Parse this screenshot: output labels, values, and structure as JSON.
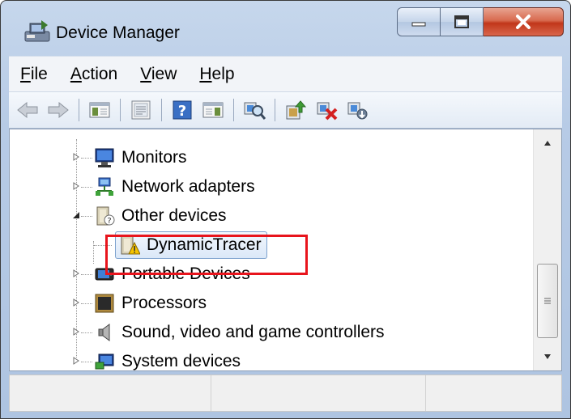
{
  "window": {
    "title": "Device Manager"
  },
  "menu": {
    "items": [
      {
        "label": "File",
        "mnemonic": "F",
        "rest": "ile"
      },
      {
        "label": "Action",
        "mnemonic": "A",
        "rest": "ction"
      },
      {
        "label": "View",
        "mnemonic": "V",
        "rest": "iew"
      },
      {
        "label": "Help",
        "mnemonic": "H",
        "rest": "elp"
      }
    ]
  },
  "toolbar": {
    "buttons": [
      "back-icon",
      "forward-icon",
      "show-hide-console-tree-icon",
      "properties-icon",
      "help-icon",
      "show-action-pane-icon",
      "scan-hardware-changes-icon",
      "update-driver-icon",
      "uninstall-icon",
      "disable-device-icon"
    ]
  },
  "tree": {
    "items": [
      {
        "label": "Monitors",
        "icon": "monitor-icon",
        "expanded": false
      },
      {
        "label": "Network adapters",
        "icon": "network-adapter-icon",
        "expanded": false
      },
      {
        "label": "Other devices",
        "icon": "unknown-device-icon",
        "expanded": true
      },
      {
        "label": "DynamicTracer",
        "icon": "warning-device-icon",
        "selected": true
      },
      {
        "label": "Portable Devices",
        "icon": "portable-device-icon",
        "expanded": false
      },
      {
        "label": "Processors",
        "icon": "processor-icon",
        "expanded": false
      },
      {
        "label": "Sound, video and game controllers",
        "icon": "speaker-icon",
        "expanded": false
      },
      {
        "label": "System devices",
        "icon": "system-device-icon",
        "expanded": false
      }
    ]
  },
  "colors": {
    "highlight": "#e8141c",
    "selection_border": "#7da2ce",
    "close_button": "#c1371a"
  }
}
